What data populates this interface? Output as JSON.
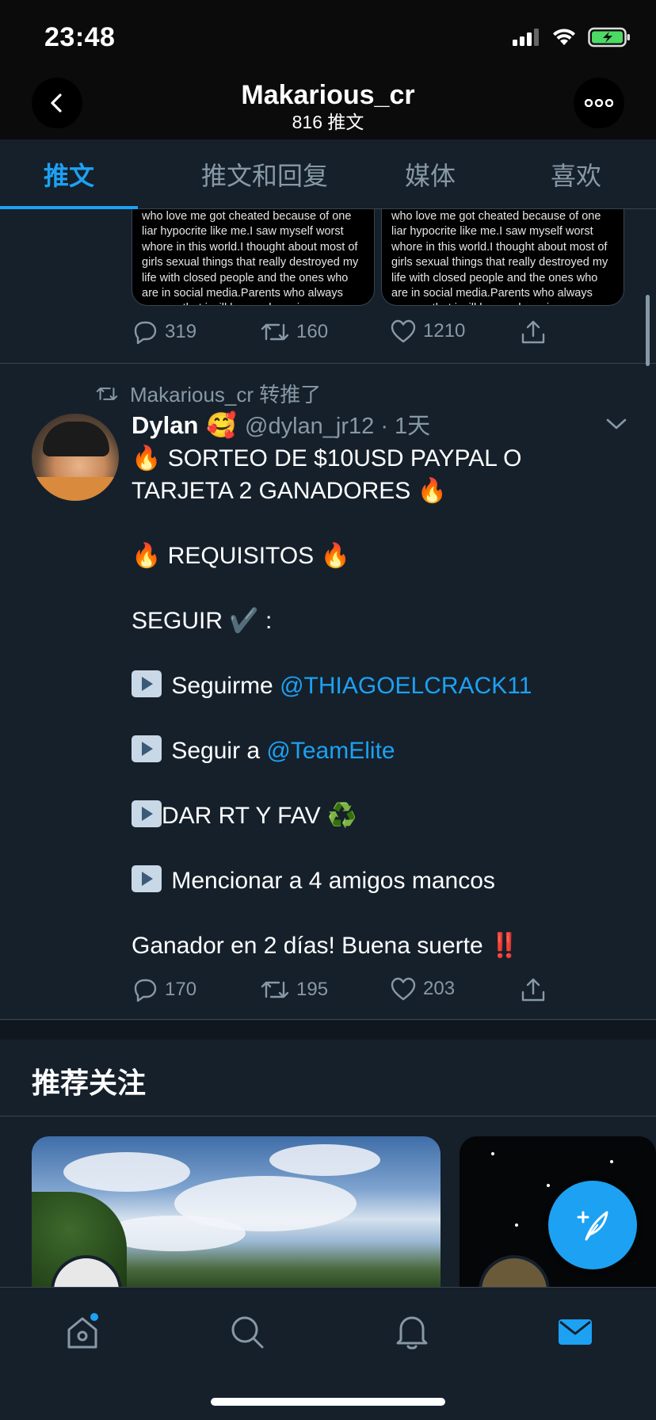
{
  "status_bar": {
    "time": "23:48"
  },
  "header": {
    "name": "Makarious_cr",
    "tweet_count": "816 推文"
  },
  "tabs": [
    {
      "label": "推文"
    },
    {
      "label": "推文和回复"
    },
    {
      "label": "媒体"
    },
    {
      "label": "喜欢"
    }
  ],
  "tweet1": {
    "media_text": "who love me got cheated because of one liar hypocrite like me.I saw myself worst whore in this world.I thought about most of girls sexual things that really destroyed my life with closed people and the ones who are in social media.Parents who always see me that i will be good one in",
    "stats": {
      "replies": "319",
      "retweets": "160",
      "likes": "1210"
    }
  },
  "tweet2": {
    "retweeted_by": "Makarious_cr 转推了",
    "author_name": "Dylan",
    "author_emoji": "🥰",
    "handle_time": "@dylan_jr12 · 1天",
    "lines": {
      "l1": "🔥 SORTEO DE $10USD PAYPAL O TARJETA 2 GANADORES 🔥",
      "l2": "🔥 REQUISITOS 🔥",
      "l3": "SEGUIR ✔️ :",
      "l4_text": "Seguirme ",
      "l4_link": "@THIAGOELCRACK11",
      "l5_text": "Seguir a ",
      "l5_link": "@TeamElite",
      "l6": "DAR RT Y FAV ♻️",
      "l7": "Mencionar a 4 amigos mancos",
      "l8": "Ganador en 2 días! Buena suerte ‼️"
    },
    "stats": {
      "replies": "170",
      "retweets": "195",
      "likes": "203"
    }
  },
  "who_to_follow": {
    "title": "推荐关注"
  },
  "colors": {
    "accent": "#1da1f2",
    "background": "#15202b",
    "muted": "#8899a6"
  },
  "nav": {
    "items": [
      "home-icon",
      "search-icon",
      "notifications-icon",
      "messages-icon"
    ]
  }
}
